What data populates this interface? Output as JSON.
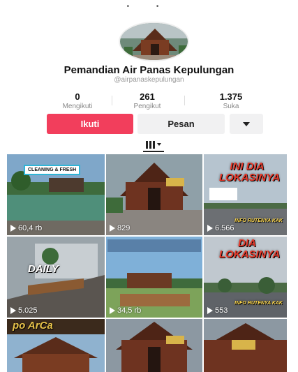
{
  "status_bar": {
    "text": "• •"
  },
  "profile": {
    "name": "Pemandian Air Panas Kepulungan",
    "handle": "@airpanaskepulungan"
  },
  "stats": [
    {
      "value": "0",
      "label": "Mengikuti"
    },
    {
      "value": "261",
      "label": "Pengikut"
    },
    {
      "value": "1.375",
      "label": "Suka"
    }
  ],
  "actions": {
    "follow_label": "Ikuti",
    "message_label": "Pesan",
    "more_icon": "chevron-down-icon"
  },
  "tab_icon": "grid-icon",
  "videos": [
    {
      "views": "60,4 rb",
      "overlay": "CLEANING & FRESH"
    },
    {
      "views": "829",
      "overlay": ""
    },
    {
      "views": "6.566",
      "overlay": "INI DIA LOKASINYA",
      "sub": "INFO RUTENYA KAK"
    },
    {
      "views": "5.025",
      "overlay": "DAILY"
    },
    {
      "views": "34,5 rb",
      "overlay": ""
    },
    {
      "views": "553",
      "overlay": "DIA LOKASINYA",
      "sub": "INFO RUTENYA KAK"
    },
    {
      "views": "",
      "overlay": "po ArCa"
    },
    {
      "views": "",
      "overlay": ""
    },
    {
      "views": "",
      "overlay": ""
    }
  ],
  "colors": {
    "accent": "#f23e5c",
    "button_bg": "#f1f1f2"
  }
}
